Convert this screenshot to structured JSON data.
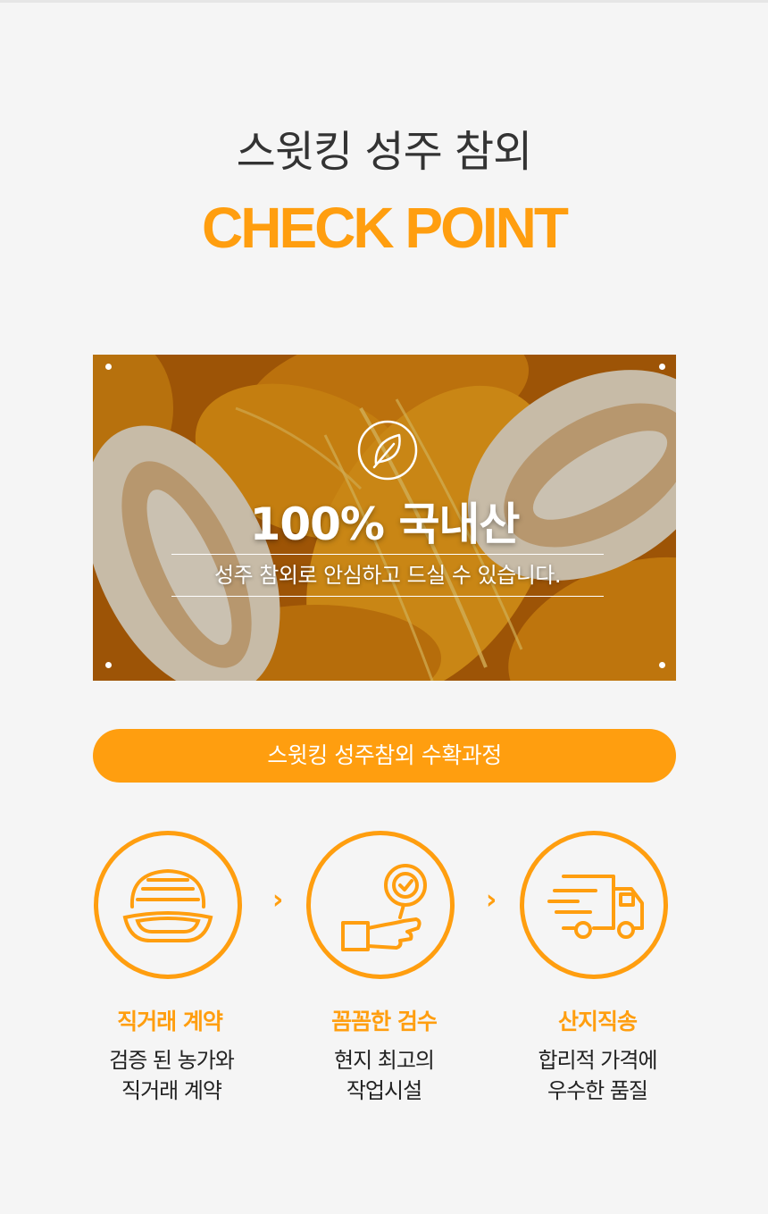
{
  "header": {
    "title": "스윗킹 성주 참외",
    "subtitle": "CHECK POINT"
  },
  "banner": {
    "icon": "leaf-icon",
    "headline": "100% 국내산",
    "caption": "성주 참외로 안심하고 드실 수 있습니다."
  },
  "process": {
    "pill_label": "스윗킹 성주참외 수확과정",
    "steps": [
      {
        "icon": "melon-icon",
        "title": "직거래 계약",
        "line1": "검증 된 농가와",
        "line2": "직거래 계약"
      },
      {
        "icon": "inspection-icon",
        "title": "꼼꼼한 검수",
        "line1": "현지 최고의",
        "line2": "작업시설"
      },
      {
        "icon": "delivery-truck-icon",
        "title": "산지직송",
        "line1": "합리적 가격에",
        "line2": "우수한 품질"
      }
    ],
    "separator": "›"
  },
  "colors": {
    "accent": "#ff9e0f",
    "text": "#333333",
    "background": "#f5f5f5"
  }
}
